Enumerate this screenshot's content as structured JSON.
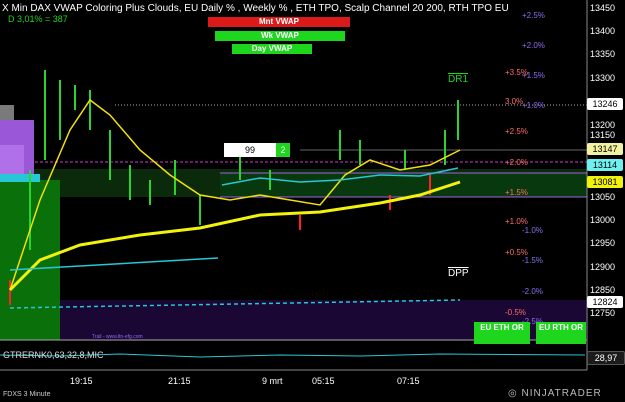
{
  "header": {
    "title": "X Min DAX VWAP Coloring Plus Clouds, EU Daily % , Weekly % , ETH TPO, Scalp Channel 20  200, RTH TPO EU",
    "delta_line": "D 3,01% = 387"
  },
  "vwap_buttons": {
    "mnt": "Mnt VWAP",
    "wk": "Wk VWAP",
    "day": "Day VWAP"
  },
  "colors": {
    "red": "#dd1a1a",
    "green": "#1fd61f",
    "yellow": "#f2f20a",
    "cyan": "#27c7d6",
    "purple": "#9b59d6",
    "pink": "#ff3ac6"
  },
  "pct_labels": {
    "left_col": [
      "+3.5%",
      "3.0%",
      "+2.5%",
      "+2.0%",
      "+1.5%",
      "+1.0%",
      "+0.5%",
      "-0.5%",
      "-1.0%"
    ],
    "right_col": [
      "+2.5%",
      "+2.0%",
      "+1.5%",
      "+1.0%",
      "-1.0%",
      "-1.5%",
      "-2.0%",
      "-2.5%"
    ]
  },
  "level_labels": {
    "dr1": "DR1",
    "dpp": "DPP"
  },
  "tpo_box": {
    "value": "99",
    "count": "2"
  },
  "price_axis": [
    "13450",
    "13400",
    "13350",
    "13300",
    "13200",
    "13150",
    "13050",
    "13000",
    "12950",
    "12900",
    "12850",
    "12750"
  ],
  "price_tags": {
    "last": "13246",
    "t1": "13147",
    "t2": "13114",
    "t3": "13081",
    "t4": "12824"
  },
  "side_boxes": {
    "eth": "EU ETH OR",
    "rth": "EU RTH OR"
  },
  "small_labels": {
    "footnote": "Trail - www.ltn-efg.com",
    "pct_small1": "-1.0%",
    "pct_small2": "-2.5%"
  },
  "lower_panel": {
    "indicator": "GTRERNK0,63,32,8,MIC",
    "value": "28,97"
  },
  "time_axis": [
    "19:15",
    "21:15",
    "9 mrt",
    "05:15",
    "07:15"
  ],
  "footer": {
    "instrument": "FDXS 3 Minute",
    "brand": "NINJATRADER"
  }
}
